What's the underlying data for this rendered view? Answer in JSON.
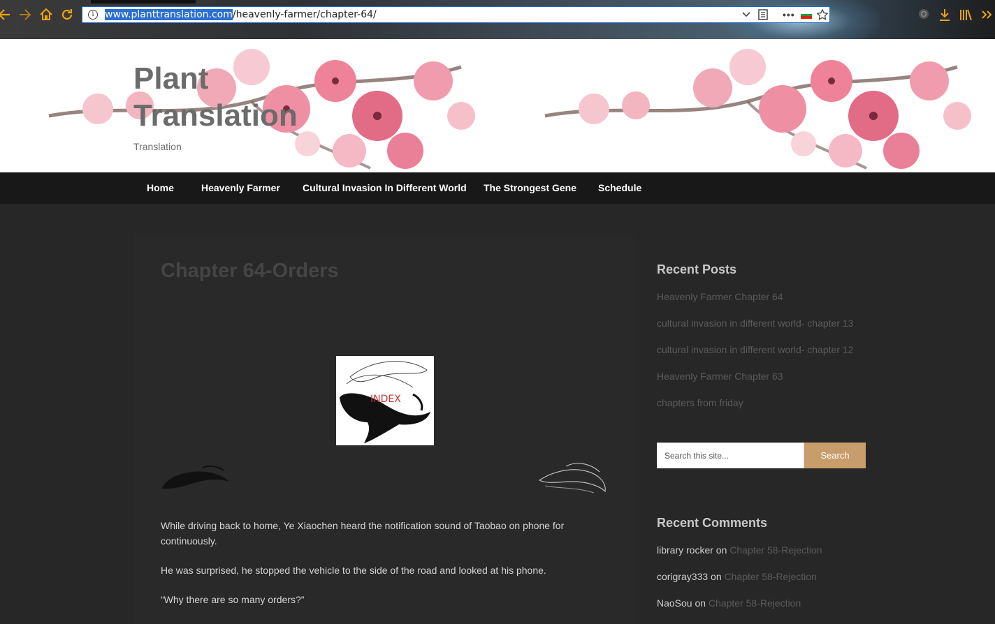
{
  "browser": {
    "url_host": "www.planttranslation.com",
    "url_path": "/heavenly-farmer/chapter-64/",
    "icons": [
      "back-icon",
      "forward-icon",
      "home-icon",
      "reload-icon",
      "info-icon",
      "dropdown-icon",
      "reader-icon",
      "more-icon",
      "flag-icon",
      "bookmark-star-icon",
      "extension-icon",
      "download-icon",
      "library-icon",
      "overflow-icon"
    ],
    "more_label": "•••"
  },
  "site": {
    "title": "Plant Translation",
    "tagline": "Translation"
  },
  "nav": {
    "items": [
      "Home",
      "Heavenly Farmer",
      "Cultural Invasion In Different World",
      "The Strongest Gene",
      "Schedule"
    ]
  },
  "post": {
    "title": "Chapter 64-Orders",
    "index_label": "INDEX",
    "paragraphs": [
      "While driving back to home, Ye Xiaochen heard the notification sound of Taobao on phone for continuously.",
      "He was surprised, he stopped the vehicle to the side of the road and looked at his phone.",
      "“Why there are so many orders?”"
    ]
  },
  "sidebar": {
    "recent_posts_title": "Recent Posts",
    "recent_posts": [
      "Heavenly Farmer Chapter 64",
      "cultural invasion in different world- chapter 13",
      "cultural invasion in different world- chapter 12",
      "Heavenly Farmer Chapter 63",
      "chapters from friday"
    ],
    "search_placeholder": "Search this site...",
    "search_button": "Search",
    "recent_comments_title": "Recent Comments",
    "comments": [
      {
        "author": "library rocker",
        "on": "on",
        "link": "Chapter 58-Rejection"
      },
      {
        "author": "corigray333",
        "on": "on",
        "link": "Chapter 58-Rejection"
      },
      {
        "author": "NaoSou",
        "on": "on",
        "link": "Chapter 58-Rejection"
      }
    ]
  },
  "colors": {
    "accent": "#c99d6b",
    "nav_bg": "#181818",
    "page_bg": "#272727",
    "browser_icon": "#f0a30a"
  }
}
